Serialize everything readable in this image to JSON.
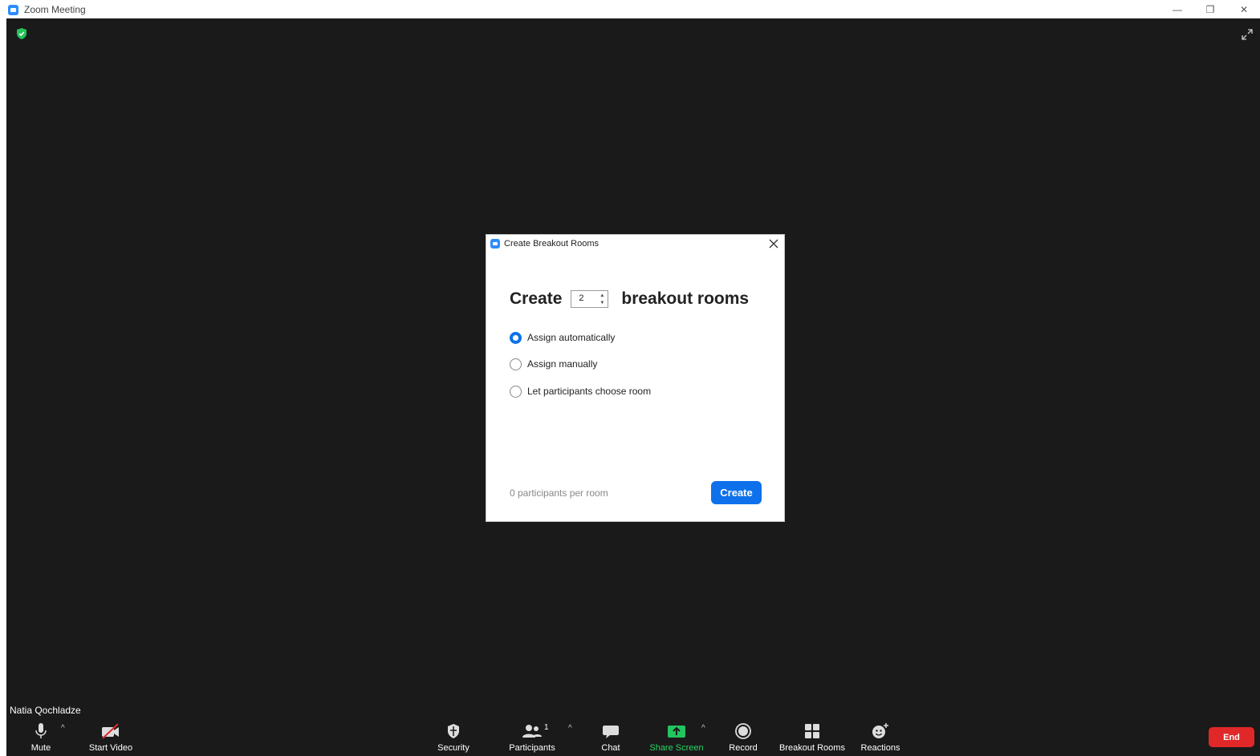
{
  "window": {
    "title": "Zoom Meeting",
    "minimize": "—",
    "restore": "❐",
    "close": "✕"
  },
  "dialog": {
    "title": "Create Breakout Rooms",
    "create_prefix": "Create",
    "room_count": "2",
    "create_suffix": "breakout rooms",
    "options": [
      {
        "label": "Assign automatically",
        "selected": true
      },
      {
        "label": "Assign manually",
        "selected": false
      },
      {
        "label": "Let participants choose room",
        "selected": false
      }
    ],
    "participants_per_room": "0 participants per room",
    "create_button": "Create"
  },
  "self_view": {
    "name": "Natia Qochladze"
  },
  "toolbar": {
    "mute": "Mute",
    "start_video": "Start Video",
    "security": "Security",
    "participants": "Participants",
    "participant_count": "1",
    "chat": "Chat",
    "share_screen": "Share Screen",
    "record": "Record",
    "breakout_rooms": "Breakout Rooms",
    "reactions": "Reactions",
    "end": "End"
  },
  "colors": {
    "accent": "#0e71eb",
    "share_green": "#22c55e",
    "end_red": "#e02828",
    "meeting_bg": "#1a1a1a"
  }
}
